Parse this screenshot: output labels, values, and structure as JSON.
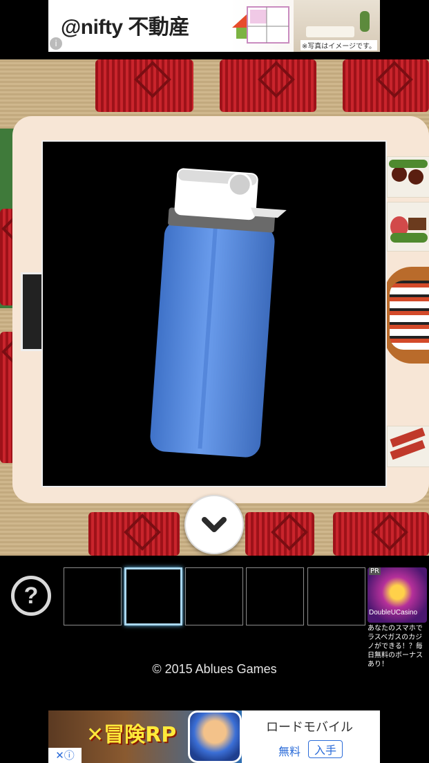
{
  "ads": {
    "top": {
      "brand": "@nifty 不動産",
      "caption": "※写真はイメージです。",
      "info_glyph": "i"
    },
    "side": {
      "pr_label": "PR",
      "name": "DoubleUCasino",
      "description": "あなたのスマホでラスベガスのカジノができる！？毎日無料のボーナスあり！"
    },
    "bottom": {
      "headline": "✕冒険RP",
      "company": "ロードモバイル",
      "free_label": "無料",
      "get_button": "入手",
      "ad_controls": "✕ⓘ"
    }
  },
  "inspect": {
    "item": "lighter",
    "item_color": "#5b8ee6",
    "cap_color": "#ffffff",
    "close_icon": "chevron-down-icon"
  },
  "inventory": {
    "help_label": "?",
    "slot_count": 5,
    "selected_slot": 2
  },
  "footer": {
    "copyright": "© 2015 Ablues Games"
  },
  "colors": {
    "background": "#000000",
    "selection_glow": "#a9d7f0",
    "slot_border": "#8d8d8d"
  }
}
